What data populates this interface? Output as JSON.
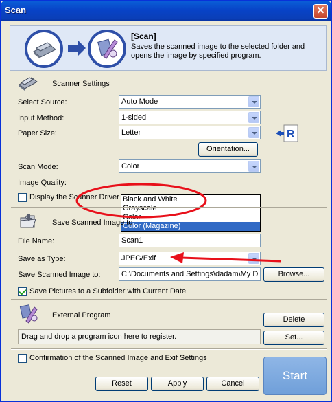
{
  "window": {
    "title": "Scan",
    "close_glyph": "✕"
  },
  "banner": {
    "title": "[Scan]",
    "description": "Saves the scanned image to the selected folder and opens the image by specified program.",
    "icons": [
      "scanner-circle-icon",
      "arrow-right-icon",
      "program-circle-icon"
    ]
  },
  "scanner_settings": {
    "heading": "Scanner Settings",
    "select_source": {
      "label": "Select Source:",
      "value": "Auto Mode"
    },
    "input_method": {
      "label": "Input Method:",
      "value": "1-sided"
    },
    "paper_size": {
      "label": "Paper Size:",
      "value": "Letter"
    },
    "orientation_button": "Orientation...",
    "scan_mode": {
      "label": "Scan Mode:",
      "value": "Color",
      "options": [
        "Black and White",
        "Grayscale",
        "Color",
        "Color (Magazine)"
      ],
      "highlighted": "Color (Magazine)"
    },
    "image_quality": {
      "label": "Image Quality:"
    },
    "display_driver": {
      "label": "Display the Scanner Driver",
      "checked": false
    }
  },
  "save_settings": {
    "heading": "Save Scanned Image to",
    "file_name": {
      "label": "File Name:",
      "value": "Scan1"
    },
    "save_as_type": {
      "label": "Save as Type:",
      "value": "JPEG/Exif"
    },
    "save_to": {
      "label": "Save Scanned Image to:",
      "value": "C:\\Documents and Settings\\dadam\\My D"
    },
    "browse_button": "Browse...",
    "subfolder": {
      "label": "Save Pictures to a Subfolder with Current Date",
      "checked": true
    }
  },
  "external_program": {
    "heading": "External Program",
    "delete_button": "Delete",
    "drop_hint": "Drag and drop a program icon here to register.",
    "set_button": "Set..."
  },
  "confirmation": {
    "label": "Confirmation of the Scanned Image and Exif Settings",
    "checked": false
  },
  "buttons": {
    "reset": "Reset",
    "apply": "Apply",
    "cancel": "Cancel",
    "start": "Start"
  },
  "colors": {
    "titlebar": "#0a5fd8",
    "annotation_red": "#e8101a",
    "selection": "#316ac5",
    "start": "#7aa7de"
  }
}
